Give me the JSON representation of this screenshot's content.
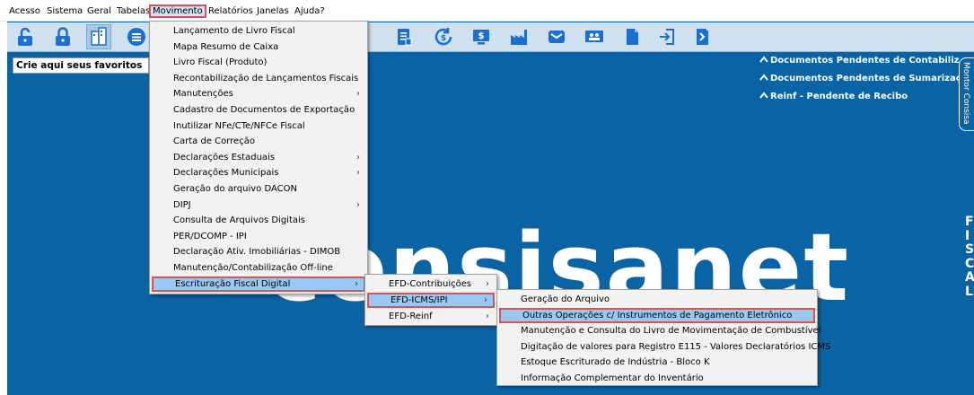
{
  "menubar": [
    "Acesso",
    "Sistema",
    "Geral",
    "Tabelas",
    "Movimento",
    "Relatórios",
    "Janelas",
    "Ajuda?"
  ],
  "favorites_label": "Crie aqui seus favoritos",
  "pending": [
    "Documentos Pendentes de Contabilizaç",
    "Documentos Pendentes de Sumarizaçã",
    "Reinf - Pendente de Recibo"
  ],
  "side_tab": "Montor Consisa",
  "side_letters": [
    "F",
    "I",
    "S",
    "C",
    "A",
    "L"
  ],
  "logo_text": "consisanet",
  "toolbar_icons": [
    "unlock-icon",
    "lock-icon",
    "company-icon",
    "list-icon",
    "report-icon",
    "document-icon",
    "refresh-money-icon",
    "money-monitor-icon",
    "factory-icon",
    "mail-icon",
    "people-icon",
    "file-icon",
    "transfer-icon",
    "tag-icon"
  ],
  "menu_movimento": [
    {
      "label": "Lançamento de Livro Fiscal",
      "sub": false
    },
    {
      "label": "Mapa Resumo de Caixa",
      "sub": false
    },
    {
      "label": "Livro Fiscal (Produto)",
      "sub": false
    },
    {
      "label": "Recontabilização de Lançamentos Fiscais",
      "sub": false
    },
    {
      "label": "Manutenções",
      "sub": true
    },
    {
      "label": "Cadastro de Documentos de Exportação",
      "sub": false
    },
    {
      "label": "Inutilizar NFe/CTe/NFCe Fiscal",
      "sub": false
    },
    {
      "label": "Carta de Correção",
      "sub": false
    },
    {
      "label": "Declarações Estaduais",
      "sub": true
    },
    {
      "label": "Declarações Municipais",
      "sub": true
    },
    {
      "label": "Geração do arquivo DACON",
      "sub": false
    },
    {
      "label": "DIPJ",
      "sub": true
    },
    {
      "label": "Consulta de Arquivos Digitais",
      "sub": false
    },
    {
      "label": "PER/DCOMP - IPI",
      "sub": false
    },
    {
      "label": "Declaração Ativ. Imobiliárias - DIMOB",
      "sub": false
    },
    {
      "label": "Manutenção/Contabilização Off-line",
      "sub": false
    },
    {
      "label": "Escrituração Fiscal Digital",
      "sub": true
    }
  ],
  "menu_efd": [
    {
      "label": "EFD-Contribuições",
      "sub": true
    },
    {
      "label": "EFD-ICMS/IPI",
      "sub": true
    },
    {
      "label": "EFD-Reinf",
      "sub": true
    }
  ],
  "menu_icms": [
    {
      "label": "Geração do Arquivo"
    },
    {
      "label": "Outras Operações c/ Instrumentos de Pagamento Eletrônico"
    },
    {
      "label": "Manutenção e Consulta do Livro de Movimentação de Combustível"
    },
    {
      "label": "Digitação de valores para Registro E115 - Valores Declaratórios ICMS"
    },
    {
      "label": "Estoque Escriturado de Indústria - Bloco K"
    },
    {
      "label": "Informação Complementar do Inventário"
    }
  ],
  "arrow_glyph": "›"
}
